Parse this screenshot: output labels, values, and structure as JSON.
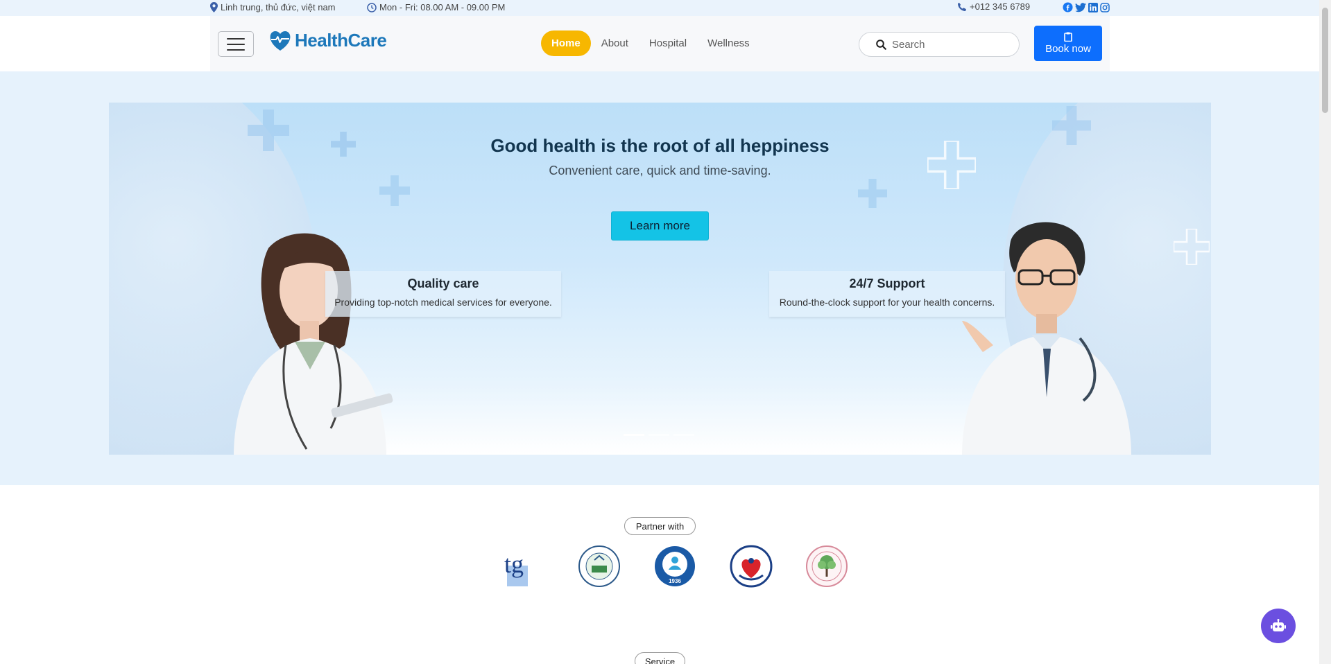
{
  "topbar": {
    "address": "Linh trung, thủ đức, việt nam",
    "hours": "Mon - Fri: 08.00 AM - 09.00 PM",
    "phone": "+012 345 6789",
    "social_icons": [
      "facebook-icon",
      "twitter-icon",
      "linkedin-icon",
      "instagram-icon"
    ]
  },
  "header": {
    "logo_text": "HealthCare",
    "nav": [
      {
        "label": "Home",
        "active": true
      },
      {
        "label": "About",
        "active": false
      },
      {
        "label": "Hospital",
        "active": false
      },
      {
        "label": "Wellness",
        "active": false
      }
    ],
    "search_placeholder": "Search",
    "book_label": "Book now"
  },
  "hero": {
    "title": "Good health is the root of all heppiness",
    "subtitle": "Convenient care, quick and time-saving.",
    "cta": "Learn more",
    "features": [
      {
        "title": "Quality care",
        "desc": "Providing top-notch medical services for everyone."
      },
      {
        "title": "24/7 Support",
        "desc": "Round-the-clock support for your health concerns."
      }
    ],
    "slide_indicators": 3,
    "active_slide": 1
  },
  "partners": {
    "label": "Partner with",
    "logo_text": [
      "tg",
      "1936"
    ]
  },
  "service": {
    "label": "Service"
  },
  "colors": {
    "brand": "#1d78ba",
    "nav_active": "#f7b700",
    "book_button": "#0d6efd",
    "cta": "#14c3e6",
    "chat_button": "#6b4fe0"
  }
}
